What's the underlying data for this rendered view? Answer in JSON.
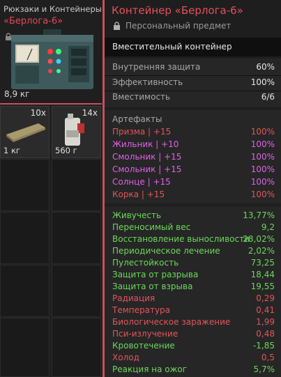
{
  "left": {
    "category": "Рюкзаки и Контейнеры",
    "name": "«Берлога-6»",
    "weight": "8,9 кг",
    "slots": [
      {
        "qty": "10x",
        "weight": "1 кг",
        "icon": "bandage-pack-icon"
      },
      {
        "qty": "14x",
        "weight": "560 г",
        "icon": "canister-icon"
      }
    ]
  },
  "right": {
    "title": "Контейнер «Берлога-6»",
    "personal": "Персональный предмет",
    "type": "Вместительный контейнер",
    "stats": [
      {
        "k": "Внутренняя защита",
        "v": "60%"
      },
      {
        "k": "Эффективность",
        "v": "100%"
      },
      {
        "k": "Вместимость",
        "v": "6/6"
      }
    ],
    "artifacts_header": "Артефакты",
    "artifacts": [
      {
        "k": "Призма | +15",
        "v": "100%",
        "color": "#e2555c"
      },
      {
        "k": "Жильник | +10",
        "v": "100%",
        "color": "#e062e8"
      },
      {
        "k": "Смольник | +15",
        "v": "100%",
        "color": "#e062e8"
      },
      {
        "k": "Смольник | +15",
        "v": "100%",
        "color": "#e062e8"
      },
      {
        "k": "Солнце | +15",
        "v": "100%",
        "color": "#e062e8"
      },
      {
        "k": "Корка | +15",
        "v": "100%",
        "color": "#e2555c"
      }
    ],
    "effects": [
      {
        "k": "Живучесть",
        "v": "13,77%",
        "color": "#6cd85c"
      },
      {
        "k": "Переносимый вес",
        "v": "9,2",
        "color": "#6cd85c"
      },
      {
        "k": "Восстановление выносливости",
        "v": "28,02%",
        "color": "#6cd85c"
      },
      {
        "k": "Периодическое лечение",
        "v": "2,02%",
        "color": "#6cd85c"
      },
      {
        "k": "Пулестойкость",
        "v": "73,25",
        "color": "#6cd85c"
      },
      {
        "k": "Защита от разрыва",
        "v": "18,44",
        "color": "#6cd85c"
      },
      {
        "k": "Защита от взрыва",
        "v": "19,55",
        "color": "#6cd85c"
      },
      {
        "k": "Радиация",
        "v": "0,29",
        "color": "#e2555c"
      },
      {
        "k": "Температура",
        "v": "0,41",
        "color": "#e2555c"
      },
      {
        "k": "Биологическое заражение",
        "v": "1,99",
        "color": "#e2555c"
      },
      {
        "k": "Пси-излучение",
        "v": "0,48",
        "color": "#e2555c"
      },
      {
        "k": "Кровотечение",
        "v": "-1,85",
        "color": "#6cd85c"
      },
      {
        "k": "Холод",
        "v": "0,5",
        "color": "#e2555c"
      },
      {
        "k": "Реакция на ожог",
        "v": "5,7%",
        "color": "#6cd85c"
      }
    ]
  }
}
